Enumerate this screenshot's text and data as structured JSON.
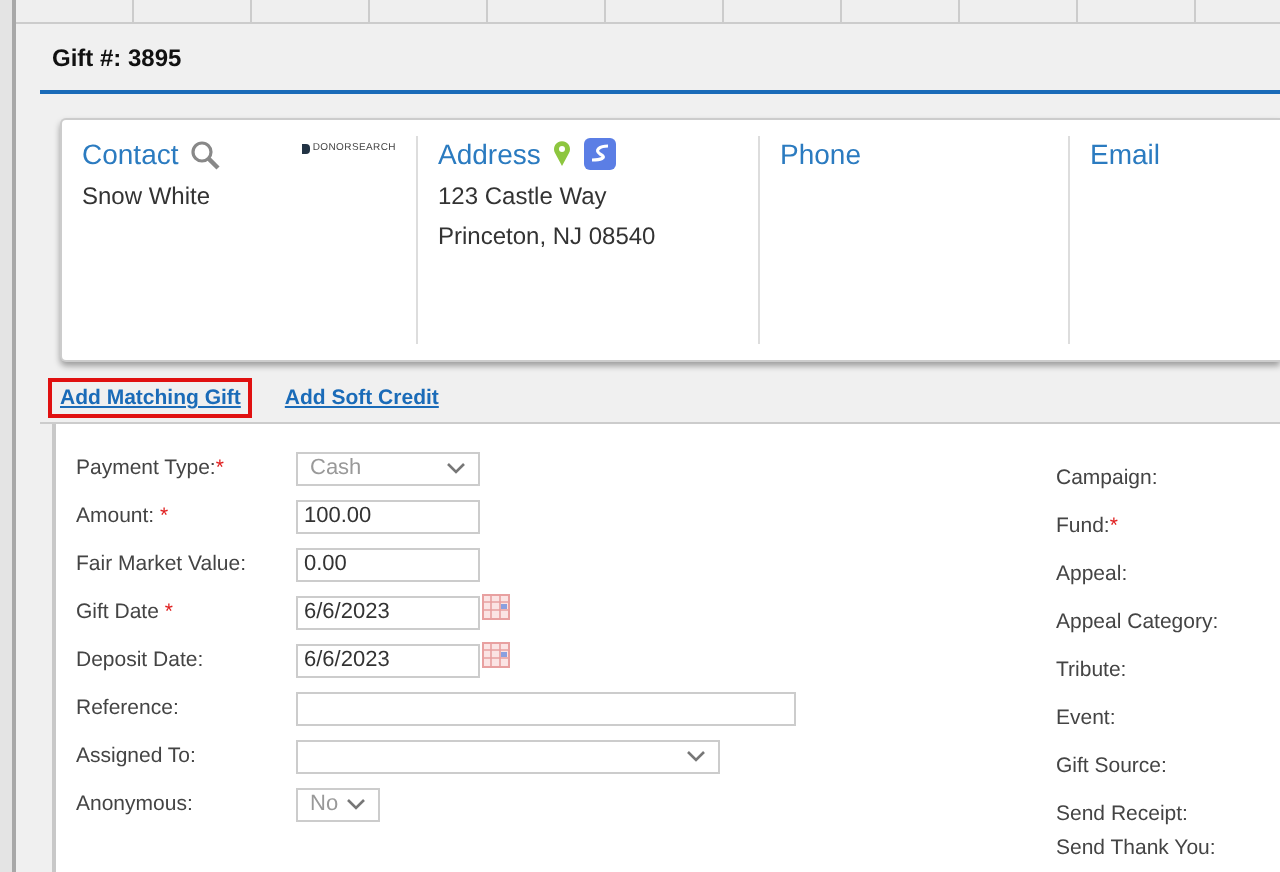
{
  "header": {
    "title": "Gift #: 3895"
  },
  "contact_card": {
    "columns": [
      {
        "kind": "contact",
        "heading": "Contact",
        "lines": [
          "Snow White"
        ]
      },
      {
        "kind": "address",
        "heading": "Address",
        "lines": [
          "123 Castle Way",
          "Princeton, NJ 08540"
        ]
      },
      {
        "kind": "plain",
        "heading": "Phone"
      },
      {
        "kind": "plain",
        "heading": "Email"
      }
    ],
    "badge": "DONORSEARCH"
  },
  "links": [
    {
      "label": "Add Matching Gift",
      "highlighted": true
    },
    {
      "label": "Add Soft Credit",
      "highlighted": false
    }
  ],
  "form_left": [
    {
      "label": "Payment Type:",
      "required_mark": "*",
      "kind": "select",
      "value": "Cash"
    },
    {
      "label": "Amount: ",
      "required_mark": "*",
      "kind": "text",
      "value": "100.00"
    },
    {
      "label": "Fair Market Value:",
      "kind": "text",
      "value": "0.00"
    },
    {
      "label": "Gift Date ",
      "required_mark": "*",
      "kind": "date",
      "value": "6/6/2023"
    },
    {
      "label": "Deposit Date:",
      "kind": "date",
      "value": "6/6/2023"
    },
    {
      "label": "Reference:",
      "kind": "text"
    },
    {
      "label": "Assigned To:",
      "kind": "select"
    },
    {
      "label": "Anonymous:",
      "kind": "select",
      "value": "No"
    }
  ],
  "form_right": [
    {
      "label": "Campaign:"
    },
    {
      "label": "Fund:",
      "required_mark": "*"
    },
    {
      "label": "Appeal:"
    },
    {
      "label": "Appeal Category:"
    },
    {
      "label": "Tribute:"
    },
    {
      "label": "Event:"
    },
    {
      "label": "Gift Source:"
    },
    {
      "label": "Send Receipt:"
    },
    {
      "label": "Send Thank You:"
    }
  ]
}
